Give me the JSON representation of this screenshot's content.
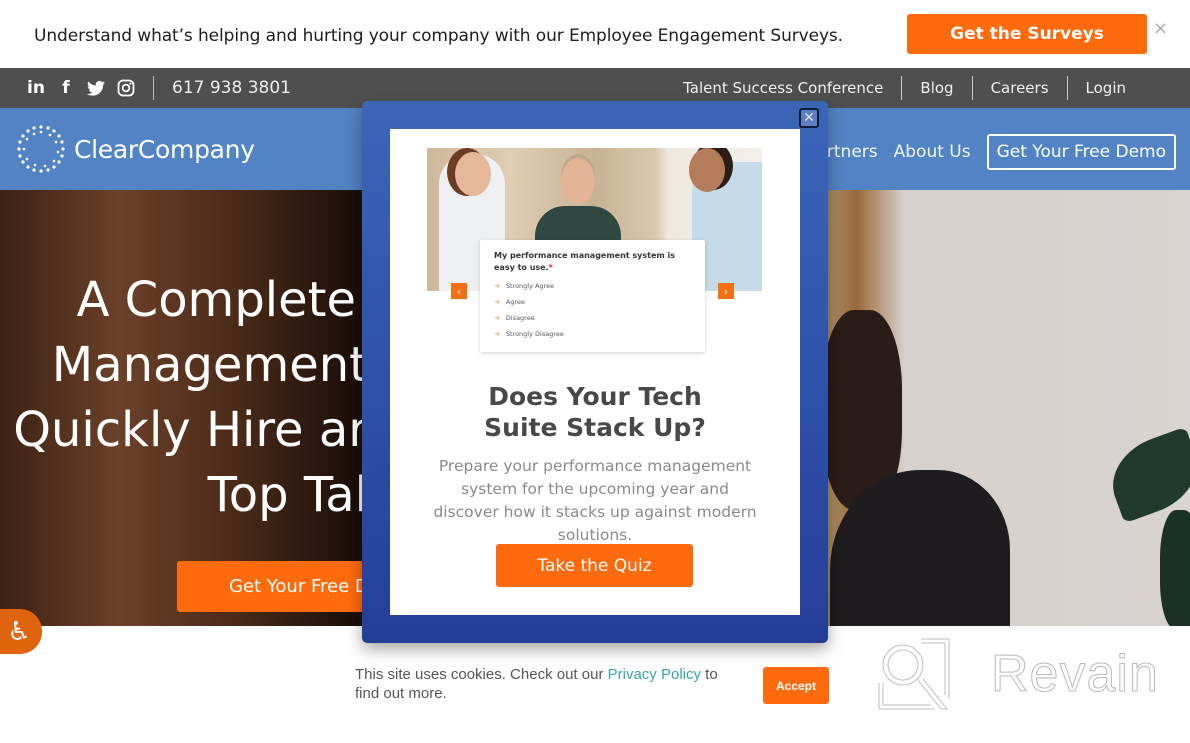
{
  "announcement": {
    "text": "Understand what’s helping and hurting your company with our Employee Engagement Surveys.",
    "cta_label": "Get the Surveys",
    "close_glyph": "×"
  },
  "topbar": {
    "social": [
      {
        "name": "linkedin-icon",
        "glyph": "in"
      },
      {
        "name": "facebook-icon",
        "glyph": "f"
      },
      {
        "name": "twitter-icon",
        "glyph": "🐦"
      },
      {
        "name": "instagram-icon",
        "glyph": "◎"
      }
    ],
    "phone": "617 938 3801",
    "links": [
      "Talent Success Conference",
      "Blog",
      "Careers",
      "Login"
    ]
  },
  "nav": {
    "logo_text": "ClearCompany",
    "links": [
      "Partners",
      "About Us"
    ],
    "demo_label": "Get Your Free Demo"
  },
  "hero": {
    "title_lines": [
      "A Complete",
      "Management",
      "Quickly Hire ar",
      "Top Tal"
    ],
    "cta_label": "Get Your Free Demo"
  },
  "accessibility": {
    "glyph": "♿"
  },
  "modal": {
    "close_glyph": "✕",
    "quiz_card": {
      "question": "My performance management system is easy to use.",
      "required_mark": "*",
      "options": [
        "Strongly Agree",
        "Agree",
        "Disagree",
        "Strongly Disagree"
      ]
    },
    "arrow_left": "‹",
    "arrow_right": "›",
    "heading_line1": "Does Your Tech",
    "heading_line2": "Suite Stack Up?",
    "body": "Prepare your performance management system for the upcoming year and discover how it stacks up against modern solutions.",
    "cta_label": "Take the Quiz"
  },
  "cookie": {
    "text_before": "This site uses cookies. Check out our ",
    "link_label": "Privacy Policy",
    "text_after": " to find out more.",
    "accept_label": "Accept"
  },
  "watermark": {
    "text": "Revain"
  },
  "colors": {
    "accent_orange": "#ff6a0c",
    "nav_blue": "#5283c4",
    "modal_blue": "#2d50a8",
    "topbar_gray": "#4f4f4f",
    "link_teal": "#3aa3ad"
  }
}
